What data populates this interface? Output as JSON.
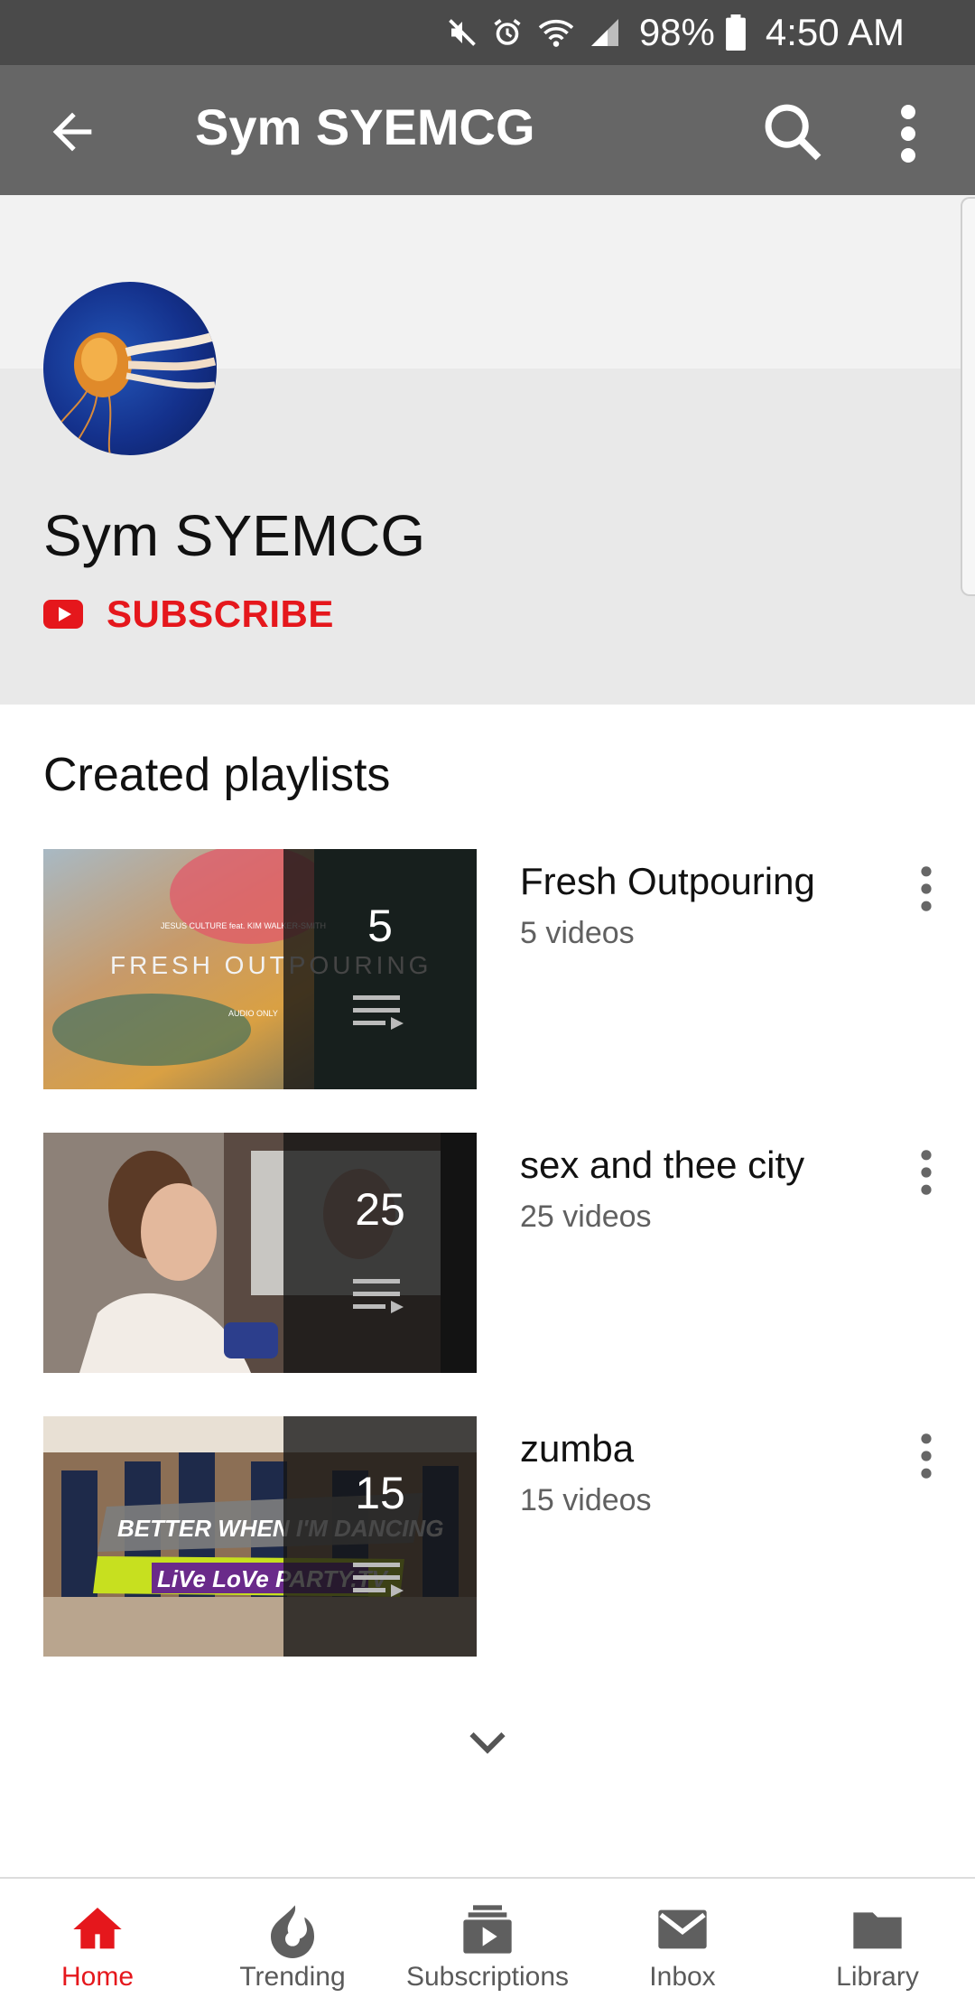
{
  "status_bar": {
    "battery": "98%",
    "time": "4:50 AM",
    "icons": [
      "mute-icon",
      "alarm-icon",
      "wifi-icon",
      "signal-icon",
      "battery-icon"
    ]
  },
  "toolbar": {
    "title": "Sym SYEMCG",
    "back_icon": "back-arrow-icon",
    "search_icon": "search-icon",
    "more_icon": "more-vert-icon"
  },
  "channel": {
    "name": "Sym SYEMCG",
    "subscribe_label": "SUBSCRIBE",
    "avatar_icon": "jellyfish-avatar"
  },
  "playlists_section": {
    "title": "Created playlists",
    "items": [
      {
        "title": "Fresh Outpouring",
        "subtitle": "5 videos",
        "count": "5",
        "thumb_text": [
          "JESUS CULTURE feat. KIM WALKER-SMITH",
          "FRESH OUTPOURING",
          "AUDIO ONLY"
        ]
      },
      {
        "title": "sex and thee city",
        "subtitle": "25 videos",
        "count": "25"
      },
      {
        "title": "zumba",
        "subtitle": "15 videos",
        "count": "15",
        "thumb_text": [
          "BETTER WHEN I'M DANCING",
          "LiVe LoVe PARTY.TV"
        ]
      }
    ]
  },
  "bottom_nav": {
    "items": [
      {
        "label": "Home",
        "icon": "home-icon",
        "active": true
      },
      {
        "label": "Trending",
        "icon": "trending-flame-icon",
        "active": false
      },
      {
        "label": "Subscriptions",
        "icon": "subscriptions-icon",
        "active": false
      },
      {
        "label": "Inbox",
        "icon": "inbox-mail-icon",
        "active": false
      },
      {
        "label": "Library",
        "icon": "library-folder-icon",
        "active": false
      }
    ]
  },
  "colors": {
    "status_bar": "#4a4a4a",
    "toolbar": "#666666",
    "accent_red": "#e5171c",
    "header_bg": "#e9e9e9"
  }
}
